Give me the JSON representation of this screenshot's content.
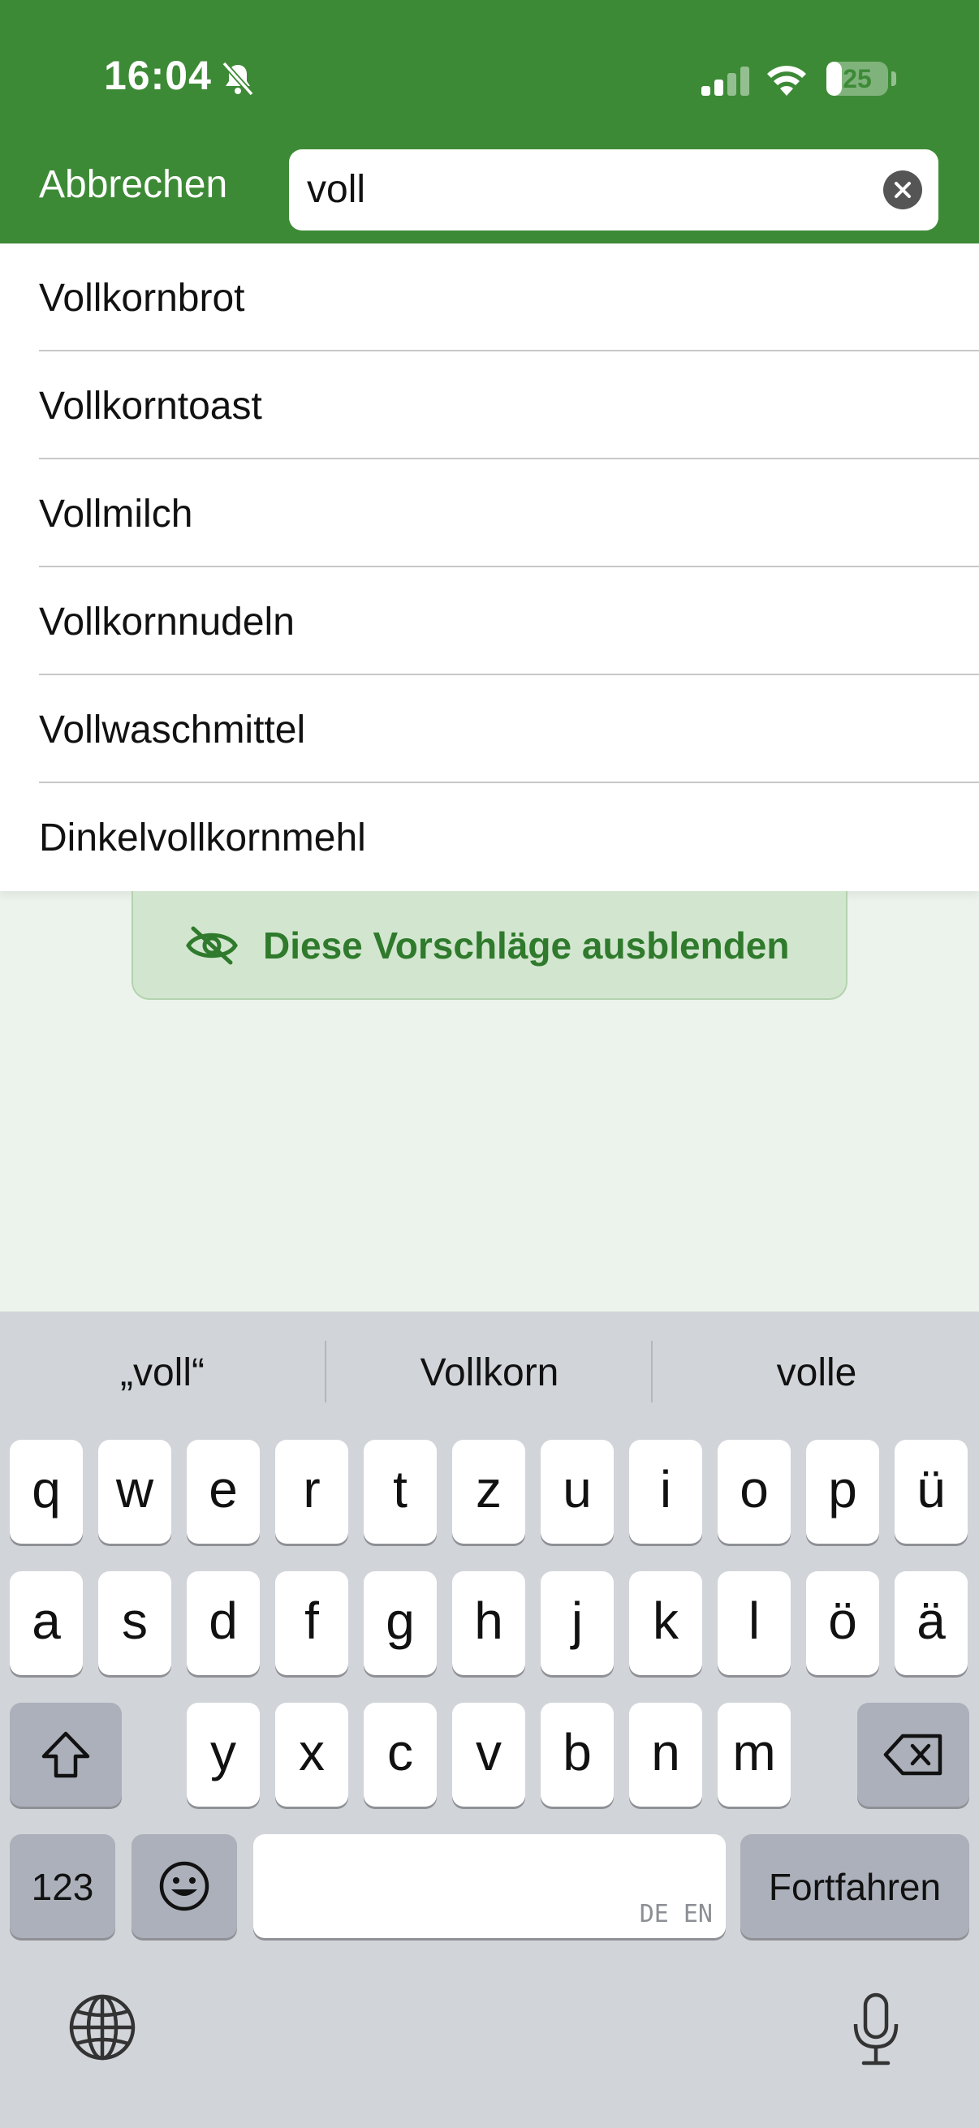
{
  "status_bar": {
    "time": "16:04",
    "battery_level": "25",
    "battery_fraction": 0.25,
    "icons": [
      "bell-slash-icon",
      "cellular-signal-icon",
      "wifi-icon",
      "battery-icon"
    ]
  },
  "search": {
    "cancel_label": "Abbrechen",
    "query": "voll",
    "clear_icon": "clear-circle-icon"
  },
  "suggestions": [
    {
      "label": "Vollkornbrot"
    },
    {
      "label": "Vollkorntoast"
    },
    {
      "label": "Vollmilch"
    },
    {
      "label": "Vollkornnudeln"
    },
    {
      "label": "Vollwaschmittel"
    },
    {
      "label": "Dinkelvollkornmehl"
    }
  ],
  "hide_suggestions": {
    "label": "Diese Vorschläge ausblenden",
    "icon": "eye-slash-icon"
  },
  "keyboard": {
    "predictions": [
      "„voll“",
      "Vollkorn",
      "volle"
    ],
    "row1": [
      "q",
      "w",
      "e",
      "r",
      "t",
      "z",
      "u",
      "i",
      "o",
      "p",
      "ü"
    ],
    "row2": [
      "a",
      "s",
      "d",
      "f",
      "g",
      "h",
      "j",
      "k",
      "l",
      "ö",
      "ä"
    ],
    "row3": [
      "y",
      "x",
      "c",
      "v",
      "b",
      "n",
      "m"
    ],
    "numbers_label": "123",
    "return_label": "Fortfahren",
    "space_hint": "DE EN",
    "icons": [
      "shift-icon",
      "backspace-icon",
      "emoji-icon",
      "globe-icon",
      "microphone-icon"
    ]
  },
  "colors": {
    "header": "#3d8a36",
    "accent_text": "#2f7a2c",
    "hide_button_bg": "#d2e6cf",
    "background": "#ecf3ec",
    "keyboard_bg": "#d1d4d9"
  }
}
